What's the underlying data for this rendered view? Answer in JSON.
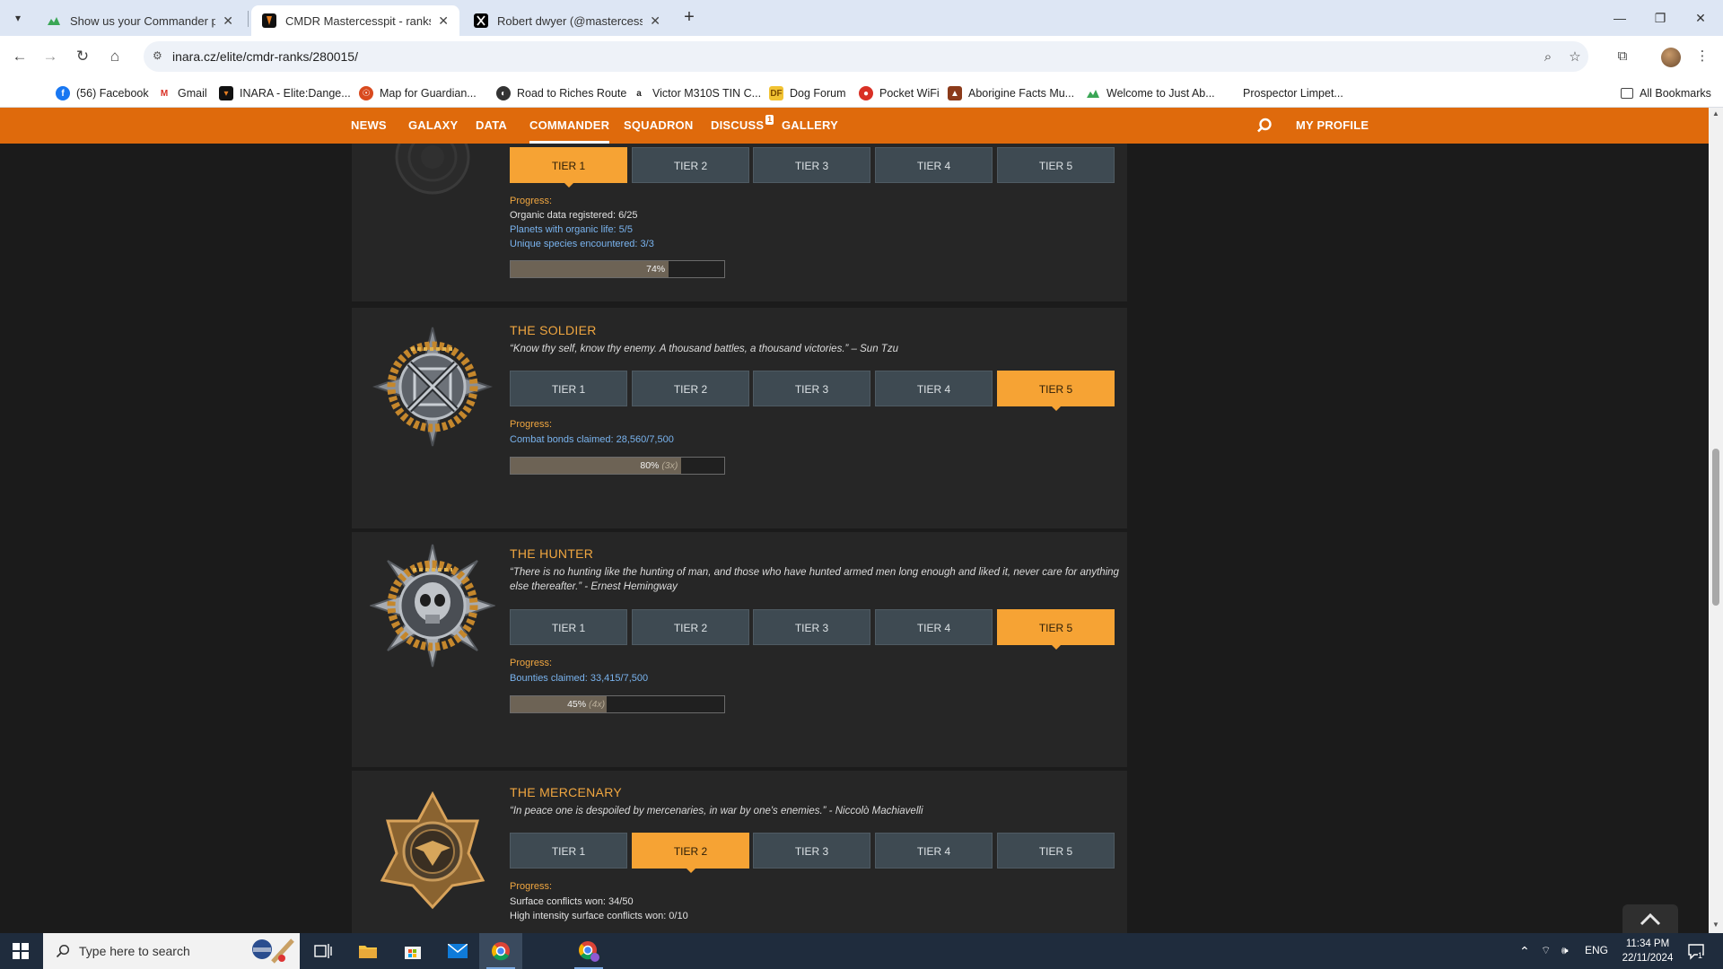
{
  "browser": {
    "tabs": [
      {
        "title": "Show us your Commander prof",
        "active": false
      },
      {
        "title": "CMDR Mastercesspit - ranks | E",
        "active": true
      },
      {
        "title": "Robert dwyer (@mastercesspit)",
        "active": false
      }
    ],
    "url": "inara.cz/elite/cmdr-ranks/280015/",
    "bookmarks": [
      "(56) Facebook",
      "Gmail",
      "INARA - Elite:Dange...",
      "Map for Guardian...",
      "Road to Riches Route",
      "Victor M310S TIN C...",
      "Dog Forum",
      "Pocket WiFi",
      "Aborigine Facts Mu...",
      "Welcome to Just Ab...",
      "Prospector Limpet..."
    ],
    "all_bookmarks": "All Bookmarks"
  },
  "site_nav": {
    "items": [
      "NEWS",
      "GALAXY",
      "DATA",
      "COMMANDER",
      "SQUADRON",
      "DISCUSS",
      "GALLERY"
    ],
    "active": "COMMANDER",
    "discuss_badge": "1",
    "profile": "MY PROFILE"
  },
  "ranks": [
    {
      "title": "",
      "quote": "",
      "tiers": [
        "TIER 1",
        "TIER 2",
        "TIER 3",
        "TIER 4",
        "TIER 5"
      ],
      "active_tier": 1,
      "progress_label": "Progress:",
      "lines": [
        {
          "text": "Organic data registered: 6/25",
          "style": "plain"
        },
        {
          "text": "Planets with organic life: 5/5",
          "style": "link"
        },
        {
          "text": "Unique species encountered: 3/3",
          "style": "link"
        }
      ],
      "percent": 74,
      "percent_text": "74%",
      "multiplier": ""
    },
    {
      "title": "THE SOLDIER",
      "quote": "“Know thy self, know thy enemy. A thousand battles, a thousand victories.” – Sun Tzu",
      "tiers": [
        "TIER 1",
        "TIER 2",
        "TIER 3",
        "TIER 4",
        "TIER 5"
      ],
      "active_tier": 5,
      "progress_label": "Progress:",
      "lines": [
        {
          "text": "Combat bonds claimed: 28,560/7,500",
          "style": "link"
        }
      ],
      "percent": 80,
      "percent_text": "80%",
      "multiplier": "(3x)"
    },
    {
      "title": "THE HUNTER",
      "quote": "“There is no hunting like the hunting of man, and those who have hunted armed men long enough and liked it, never care for anything else thereafter.” - Ernest Hemingway",
      "tiers": [
        "TIER 1",
        "TIER 2",
        "TIER 3",
        "TIER 4",
        "TIER 5"
      ],
      "active_tier": 5,
      "progress_label": "Progress:",
      "lines": [
        {
          "text": "Bounties claimed: 33,415/7,500",
          "style": "link"
        }
      ],
      "percent": 45,
      "percent_text": "45%",
      "multiplier": "(4x)"
    },
    {
      "title": "THE MERCENARY",
      "quote": "“In peace one is despoiled by mercenaries, in war by one's enemies.” - Niccolò Machiavelli",
      "tiers": [
        "TIER 1",
        "TIER 2",
        "TIER 3",
        "TIER 4",
        "TIER 5"
      ],
      "active_tier": 2,
      "progress_label": "Progress:",
      "lines": [
        {
          "text": "Surface conflicts won: 34/50",
          "style": "plain"
        },
        {
          "text": "High intensity surface conflicts won: 0/10",
          "style": "plain"
        }
      ],
      "percent": null,
      "percent_text": "",
      "multiplier": ""
    }
  ],
  "taskbar": {
    "search_placeholder": "Type here to search",
    "language": "ENG",
    "time": "11:34 PM",
    "date": "22/11/2024",
    "notification_count": "1"
  },
  "colors": {
    "nav_orange": "#df6a0c",
    "tier_active": "#f6a334",
    "tier_inactive": "#3e4a52",
    "card_bg": "#262626",
    "page_bg": "#1b1b1b",
    "title_gold": "#f0a640",
    "link_blue": "#79b3ee"
  }
}
